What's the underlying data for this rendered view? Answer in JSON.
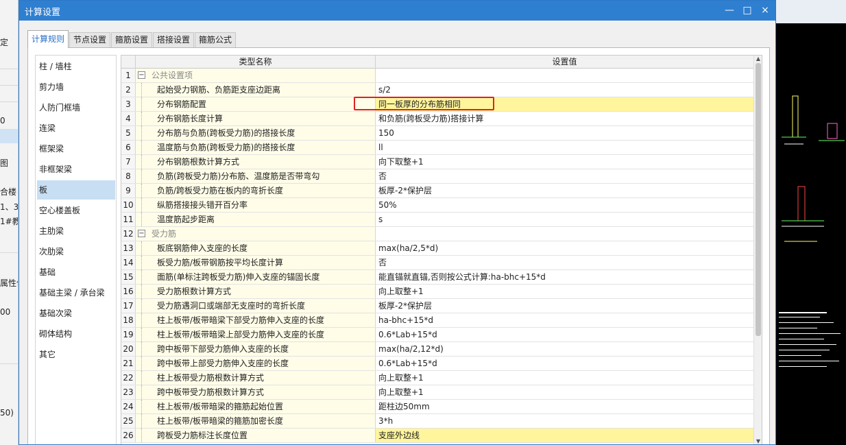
{
  "background_app": {
    "left_labels": [
      {
        "text": "定",
        "row": 0
      },
      {
        "text": "",
        "row": 1
      },
      {
        "text": "0",
        "row": 2
      },
      {
        "text": "图",
        "row": 3
      },
      {
        "text": "合楼",
        "row": 4
      },
      {
        "text": "1、3",
        "row": 5
      },
      {
        "text": "1#教",
        "row": 6
      },
      {
        "text": "属性值",
        "row": 7
      },
      {
        "text": "00",
        "row": 8
      },
      {
        "text": "50)",
        "row": 9
      }
    ]
  },
  "dialog": {
    "title": "计算设置",
    "window_buttons": {
      "minimize": "—",
      "maximize": "□",
      "close": "×"
    },
    "tabs": [
      {
        "label": "计算规则",
        "active": true
      },
      {
        "label": "节点设置",
        "active": false
      },
      {
        "label": "箍筋设置",
        "active": false
      },
      {
        "label": "搭接设置",
        "active": false
      },
      {
        "label": "箍筋公式",
        "active": false
      }
    ],
    "categories": [
      {
        "label": "柱 / 墙柱",
        "selected": false
      },
      {
        "label": "剪力墙",
        "selected": false
      },
      {
        "label": "人防门框墙",
        "selected": false
      },
      {
        "label": "连梁",
        "selected": false
      },
      {
        "label": "框架梁",
        "selected": false
      },
      {
        "label": "非框架梁",
        "selected": false
      },
      {
        "label": "板",
        "selected": true
      },
      {
        "label": "空心楼盖板",
        "selected": false
      },
      {
        "label": "主肋梁",
        "selected": false
      },
      {
        "label": "次肋梁",
        "selected": false
      },
      {
        "label": "基础",
        "selected": false
      },
      {
        "label": "基础主梁 / 承台梁",
        "selected": false
      },
      {
        "label": "基础次梁",
        "selected": false
      },
      {
        "label": "砌体结构",
        "selected": false
      },
      {
        "label": "其它",
        "selected": false
      }
    ],
    "grid": {
      "headers": {
        "name": "类型名称",
        "value": "设置值"
      },
      "rows": [
        {
          "num": "1",
          "name": "公共设置项",
          "value": "",
          "group": true,
          "toggle": "−"
        },
        {
          "num": "2",
          "name": "起始受力钢筋、负筋距支座边距离",
          "value": "s/2"
        },
        {
          "num": "3",
          "name": "分布钢筋配置",
          "value": "同一板厚的分布筋相同",
          "highlight": true
        },
        {
          "num": "4",
          "name": "分布钢筋长度计算",
          "value": "和负筋(跨板受力筋)搭接计算"
        },
        {
          "num": "5",
          "name": "分布筋与负筋(跨板受力筋)的搭接长度",
          "value": "150"
        },
        {
          "num": "6",
          "name": "温度筋与负筋(跨板受力筋)的搭接长度",
          "value": "ll"
        },
        {
          "num": "7",
          "name": "分布钢筋根数计算方式",
          "value": "向下取整+1"
        },
        {
          "num": "8",
          "name": "负筋(跨板受力筋)分布筋、温度筋是否带弯勾",
          "value": "否"
        },
        {
          "num": "9",
          "name": "负筋/跨板受力筋在板内的弯折长度",
          "value": "板厚-2*保护层"
        },
        {
          "num": "10",
          "name": "纵筋搭接接头错开百分率",
          "value": "50%"
        },
        {
          "num": "11",
          "name": "温度筋起步距离",
          "value": "s"
        },
        {
          "num": "12",
          "name": "受力筋",
          "value": "",
          "group": true,
          "toggle": "−"
        },
        {
          "num": "13",
          "name": "板底钢筋伸入支座的长度",
          "value": "max(ha/2,5*d)"
        },
        {
          "num": "14",
          "name": "板受力筋/板带钢筋按平均长度计算",
          "value": "否"
        },
        {
          "num": "15",
          "name": "面筋(单标注跨板受力筋)伸入支座的锚固长度",
          "value": "能直锚就直锚,否则按公式计算:ha-bhc+15*d"
        },
        {
          "num": "16",
          "name": "受力筋根数计算方式",
          "value": "向上取整+1"
        },
        {
          "num": "17",
          "name": "受力筋遇洞口或端部无支座时的弯折长度",
          "value": "板厚-2*保护层"
        },
        {
          "num": "18",
          "name": "柱上板带/板带暗梁下部受力筋伸入支座的长度",
          "value": "ha-bhc+15*d"
        },
        {
          "num": "19",
          "name": "柱上板带/板带暗梁上部受力筋伸入支座的长度",
          "value": "0.6*Lab+15*d"
        },
        {
          "num": "20",
          "name": "跨中板带下部受力筋伸入支座的长度",
          "value": "max(ha/2,12*d)"
        },
        {
          "num": "21",
          "name": "跨中板带上部受力筋伸入支座的长度",
          "value": "0.6*Lab+15*d"
        },
        {
          "num": "22",
          "name": "柱上板带受力筋根数计算方式",
          "value": "向上取整+1"
        },
        {
          "num": "23",
          "name": "跨中板带受力筋根数计算方式",
          "value": "向上取整+1"
        },
        {
          "num": "24",
          "name": "柱上板带/板带暗梁的箍筋起始位置",
          "value": "距柱边50mm"
        },
        {
          "num": "25",
          "name": "柱上板带/板带暗梁的箍筋加密长度",
          "value": "3*h"
        },
        {
          "num": "26",
          "name": "跨板受力筋标注长度位置",
          "value": "支座外边线",
          "highlight": true
        }
      ]
    }
  },
  "colors": {
    "titlebar": "#2f7fd0",
    "active_tab_text": "#2a6fc9",
    "selected_category": "#c7def3",
    "name_column_bg": "#fffde8",
    "highlight_value_bg": "#fff59c",
    "annotation_box": "#e02020"
  },
  "icons": [
    "minimize-icon",
    "maximize-icon",
    "close-icon",
    "collapse-toggle-icon",
    "scroll-up-icon",
    "scroll-down-icon"
  ]
}
